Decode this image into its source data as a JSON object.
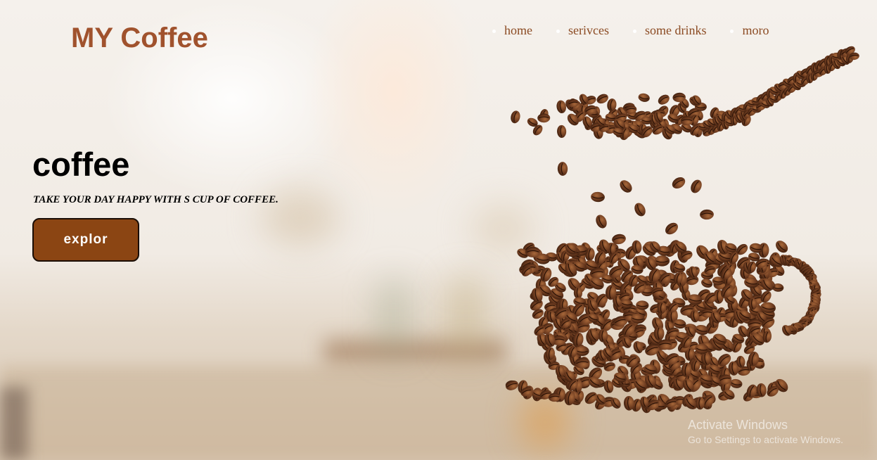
{
  "header": {
    "logo": "MY Coffee",
    "nav": [
      "home",
      "serivces",
      "some drinks",
      "moro"
    ]
  },
  "hero": {
    "title": "coffee",
    "tagline": "TAKE YOUR DAY HAPPY WITH S CUP OF COFFEE.",
    "button_label": "explor"
  },
  "watermark": {
    "title": "Activate Windows",
    "subtitle": "Go to Settings to activate Windows."
  },
  "colors": {
    "brand": "#a0522d",
    "button": "#8b4513",
    "bean": "#6b3a1f"
  },
  "icons": {
    "art": "coffee-bean-cup-illustration"
  }
}
